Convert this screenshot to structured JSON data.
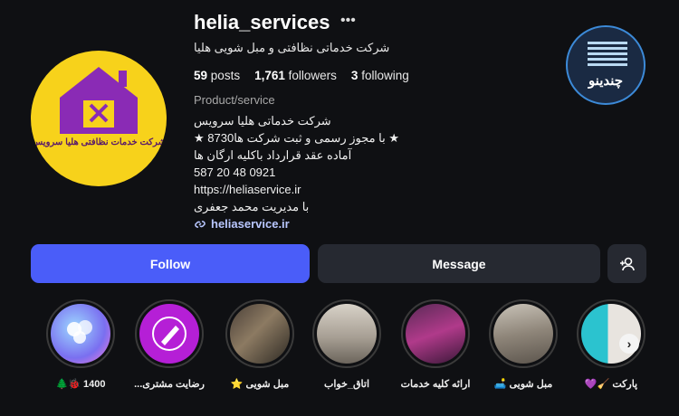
{
  "profile": {
    "username": "helia_services",
    "more_icon": "•••",
    "full_name": "شرکت خدماتی نظافتی و مبل شویی هلیا",
    "logo_text": "شرکت خدمات نظافتی هلیا سرویس",
    "stats": {
      "posts_count": "59",
      "posts_label": "posts",
      "followers_count": "1,761",
      "followers_label": "followers",
      "following_count": "3",
      "following_label": "following"
    },
    "category": "Product/service",
    "bio": {
      "line1": "شرکت خدماتی هلیا سرویس",
      "line2": "★ با مجوز رسمی و ثبت شرکت ها8730 ★",
      "line3": "آماده عقد قرارداد باکلیه ارگان ها",
      "line4": "587 20 48 0921",
      "line5": "https://heliaservice.ir",
      "line6": "با مدیریت محمد جعفری"
    },
    "link": "heliaservice.ir"
  },
  "watermark": {
    "text": "چندینو"
  },
  "actions": {
    "follow_label": "Follow",
    "message_label": "Message",
    "add_user_icon": "person-plus-icon"
  },
  "highlights": [
    {
      "label": "1400 🐞🌲"
    },
    {
      "label": "رضایت مشتری..."
    },
    {
      "label": "مبل شویی ⭐"
    },
    {
      "label": "اتاق_خواب"
    },
    {
      "label": "ارائه کلیه خدمات"
    },
    {
      "label": "مبل شویی 🛋️"
    },
    {
      "label": "پارکت 🧹💜"
    }
  ],
  "colors": {
    "follow_button": "#4a5df9",
    "secondary_button": "#262931",
    "background": "#0f1013",
    "link": "#b9c7ff"
  }
}
